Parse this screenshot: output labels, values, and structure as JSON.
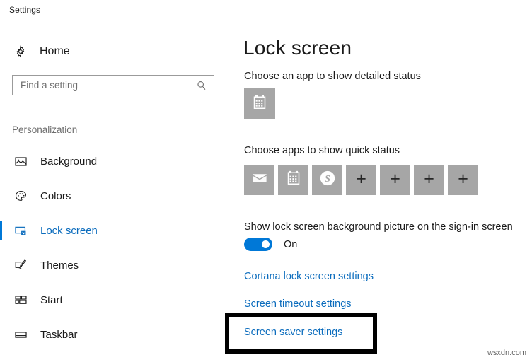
{
  "window": {
    "title": "Settings"
  },
  "sidebar": {
    "home": {
      "label": "Home",
      "icon": "gear-icon"
    },
    "search": {
      "placeholder": "Find a setting",
      "value": "",
      "icon": "search-icon"
    },
    "section_heading": "Personalization",
    "items": [
      {
        "label": "Background",
        "icon": "picture-icon",
        "selected": false
      },
      {
        "label": "Colors",
        "icon": "palette-icon",
        "selected": false
      },
      {
        "label": "Lock screen",
        "icon": "lock-screen-icon",
        "selected": true
      },
      {
        "label": "Themes",
        "icon": "brush-icon",
        "selected": false
      },
      {
        "label": "Start",
        "icon": "start-tiles-icon",
        "selected": false
      },
      {
        "label": "Taskbar",
        "icon": "taskbar-icon",
        "selected": false
      }
    ]
  },
  "main": {
    "title": "Lock screen",
    "detailed_status": {
      "label": "Choose an app to show detailed status",
      "tile": {
        "icon": "calendar-icon",
        "name": "Calendar"
      }
    },
    "quick_status": {
      "label": "Choose apps to show quick status",
      "tiles": [
        {
          "icon": "mail-icon",
          "name": "Mail"
        },
        {
          "icon": "calendar-icon",
          "name": "Calendar"
        },
        {
          "icon": "skype-icon",
          "name": "Skype"
        },
        {
          "icon": "plus-icon",
          "name": "Add app"
        },
        {
          "icon": "plus-icon",
          "name": "Add app"
        },
        {
          "icon": "plus-icon",
          "name": "Add app"
        },
        {
          "icon": "plus-icon",
          "name": "Add app"
        }
      ]
    },
    "background_toggle": {
      "label": "Show lock screen background picture on the sign-in screen",
      "state": "On",
      "checked": true
    },
    "links": [
      {
        "label": "Cortana lock screen settings",
        "highlighted": false
      },
      {
        "label": "Screen timeout settings",
        "highlighted": false
      },
      {
        "label": "Screen saver settings",
        "highlighted": true
      }
    ]
  },
  "watermark": "wsxdn.com",
  "colors": {
    "accent": "#0078d7",
    "link": "#0b6cbd",
    "tile_background": "#a6a6a6",
    "highlight_border": "#000000",
    "text": "#1a1a1a",
    "muted_text": "#6e6e6e"
  }
}
